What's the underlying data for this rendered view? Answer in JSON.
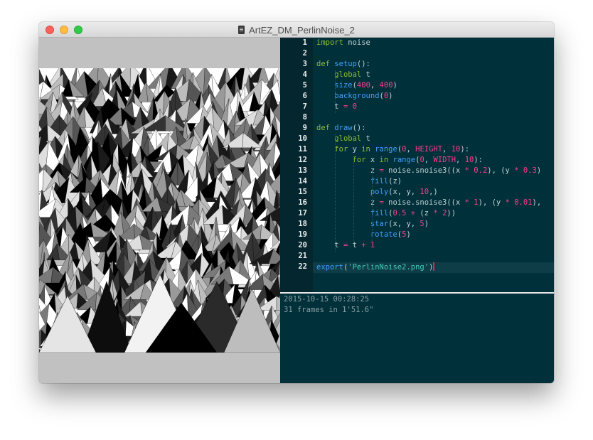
{
  "window": {
    "title": "ArtEZ_DM_PerlinNoise_2",
    "title_icon": "document-icon"
  },
  "canvas": {
    "background": "#c1c1c1",
    "render_description_icon": "perlin-noise-triangles-image"
  },
  "editor": {
    "line_numbers": [
      "1",
      "2",
      "3",
      "4",
      "5",
      "6",
      "7",
      "8",
      "9",
      "10",
      "11",
      "12",
      "13",
      "14",
      "15",
      "16",
      "17",
      "18",
      "19",
      "20",
      "21",
      "22"
    ],
    "lines": [
      "import noise",
      "",
      "def setup():",
      "    global t",
      "    size(400, 400)",
      "    background(0)",
      "    t = 0",
      "",
      "def draw():",
      "    global t",
      "    for y in range(0, HEIGHT, 10):",
      "        for x in range(0, WIDTH, 10):",
      "            z = noise.snoise3((x * 0.2), (y * 0.3)",
      "            fill(z)",
      "            poly(x, y, 10,)",
      "            z = noise.snoise3((x * 1), (y * 0.01),",
      "            fill(0.5 + (z * 2))",
      "            star(x, y, 5)",
      "            rotate(5)",
      "    t = t + 1",
      "",
      "export('PerlinNoise2.png')"
    ],
    "active_line": 22
  },
  "console": {
    "lines": [
      "2015-10-15 00:28:25",
      "31 frames in 1'51.6\""
    ]
  },
  "colors": {
    "editor_bg": "#00303a",
    "gutter_bg": "#04262e",
    "keyword": "#8fbc2e",
    "function": "#3ea0ff",
    "number": "#ff3d8e",
    "string": "#46c9b8"
  }
}
